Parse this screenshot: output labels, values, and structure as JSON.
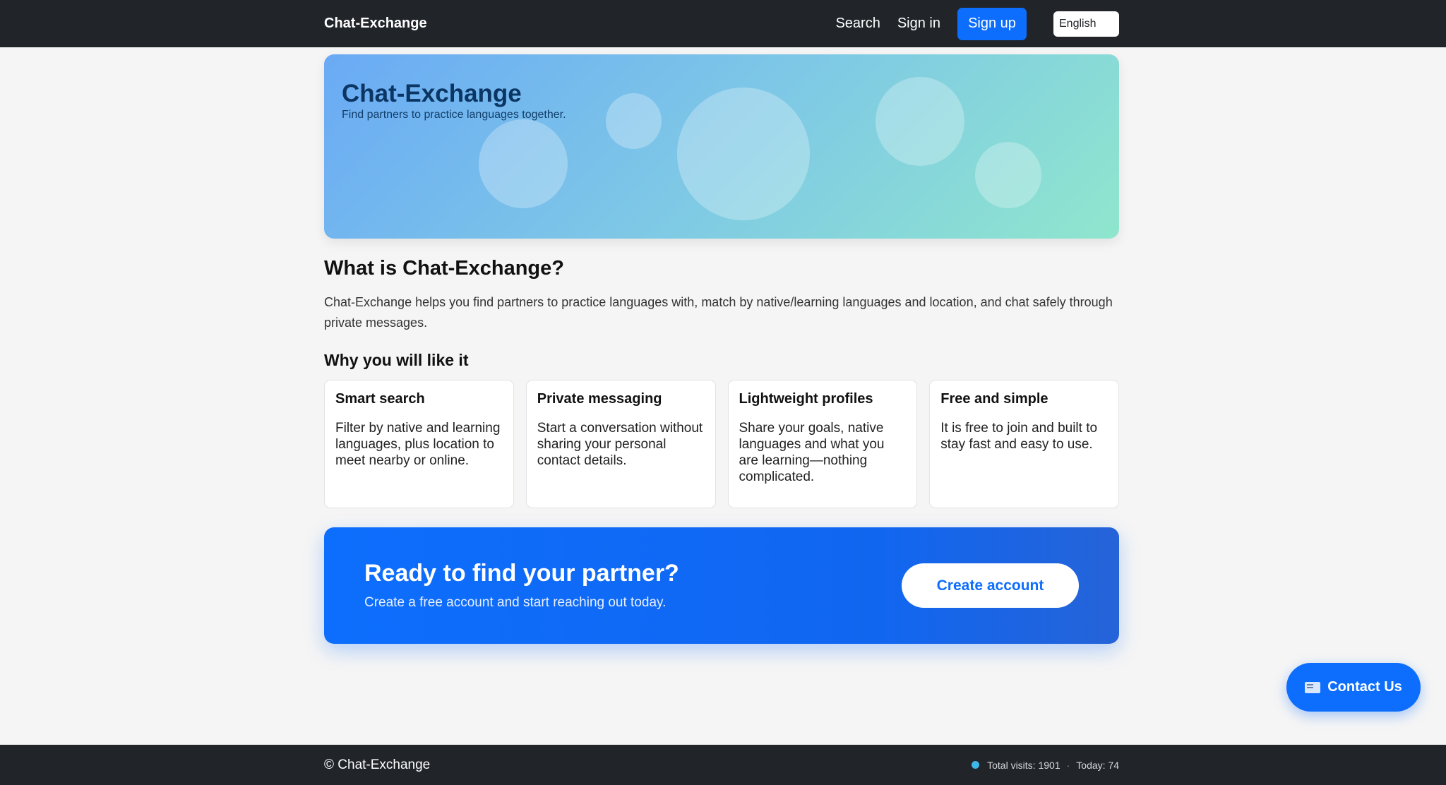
{
  "navbar": {
    "brand": "Chat-Exchange",
    "links": {
      "search": "Search",
      "signin": "Sign in",
      "signup": "Sign up"
    },
    "language": "English"
  },
  "hero": {
    "title": "Chat-Exchange",
    "subtitle": "Find partners to practice languages together."
  },
  "about": {
    "heading": "What is Chat-Exchange?",
    "paragraph": "Chat-Exchange helps you find partners to practice languages with, match by native/learning languages and location, and chat safely through private messages."
  },
  "features": {
    "heading": "Why you will like it",
    "items": [
      {
        "title": "Smart search",
        "text": "Filter by native and learning languages, plus location to meet nearby or online."
      },
      {
        "title": "Private messaging",
        "text": "Start a conversation without sharing your personal contact details."
      },
      {
        "title": "Lightweight profiles",
        "text": "Share your goals, native languages and what you are learning—nothing complicated."
      },
      {
        "title": "Free and simple",
        "text": "It is free to join and built to stay fast and easy to use."
      }
    ]
  },
  "cta": {
    "title": "Ready to find your partner?",
    "subtitle": "Create a free account and start reaching out today.",
    "button": "Create account"
  },
  "contact": {
    "label": "Contact Us",
    "icon": "mail-icon"
  },
  "footer": {
    "copyright": "© Chat-Exchange",
    "total_visits": "Total visits: 1901",
    "separator": "·",
    "today": "Today: 74"
  },
  "colors": {
    "navbar_bg": "#212529",
    "accent": "#0d6efd",
    "page_bg": "#f5f5f5"
  }
}
